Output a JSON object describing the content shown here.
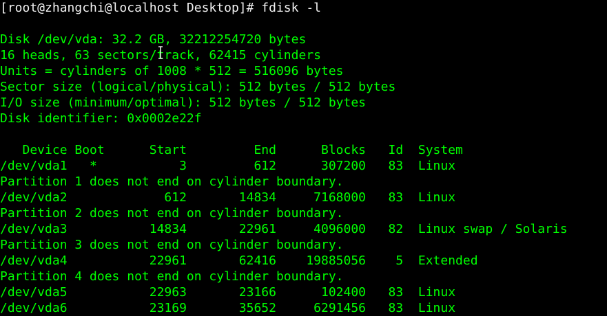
{
  "terminal": {
    "prompt": "[root@zhangchi@localhost Desktop]# fdisk -l",
    "disk_info": [
      "Disk /dev/vda: 32.2 GB, 32212254720 bytes",
      "16 heads, 63 sectors/track, 62415 cylinders",
      "Units = cylinders of 1008 * 512 = 516096 bytes",
      "Sector size (logical/physical): 512 bytes / 512 bytes",
      "I/O size (minimum/optimal): 512 bytes / 512 bytes",
      "Disk identifier: 0x0002e22f"
    ],
    "table_header": "   Device Boot      Start         End      Blocks   Id  System",
    "rows": [
      "/dev/vda1   *           3         612      307200   83  Linux",
      "Partition 1 does not end on cylinder boundary.",
      "/dev/vda2             612       14834     7168000   83  Linux",
      "Partition 2 does not end on cylinder boundary.",
      "/dev/vda3           14834       22961     4096000   82  Linux swap / Solaris",
      "Partition 3 does not end on cylinder boundary.",
      "/dev/vda4           22961       62416    19885056    5  Extended",
      "Partition 4 does not end on cylinder boundary.",
      "/dev/vda5           22963       23166      102400   83  Linux",
      "/dev/vda6           23169       35652     6291456   83  Linux"
    ],
    "colors": {
      "background": "#000000",
      "output_text": "#00ff00",
      "prompt_text": "#f2f2f2"
    }
  }
}
